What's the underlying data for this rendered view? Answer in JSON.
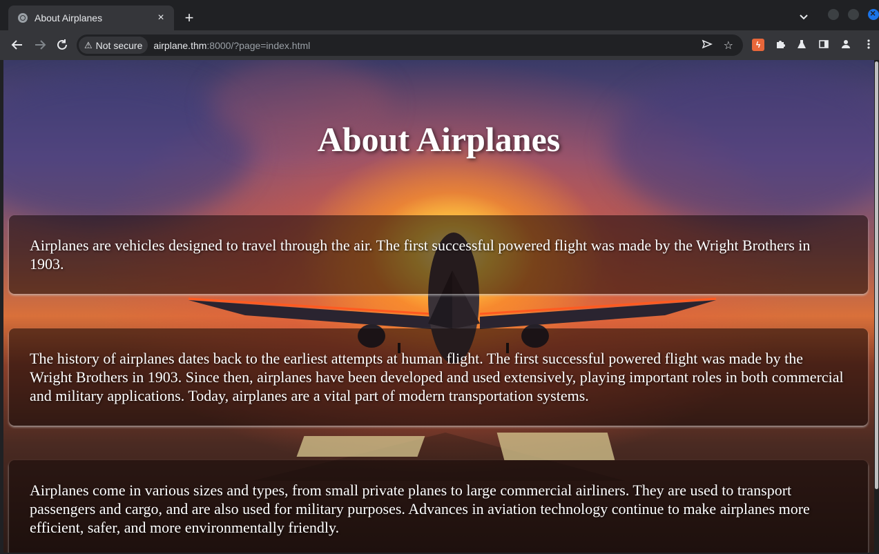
{
  "browser": {
    "tab_title": "About Airplanes",
    "tab_close": "×",
    "new_tab": "+",
    "security_label": "Not secure",
    "url_host": "airplane.thm",
    "url_rest": ":8000/?page=index.html",
    "icons": [
      "back-icon",
      "forward-icon",
      "reload-icon",
      "warning-icon",
      "send-icon",
      "star-icon",
      "burp-extension-icon",
      "puzzle-icon",
      "flask-icon",
      "side-panel-icon",
      "profile-icon",
      "menu-icon"
    ]
  },
  "page": {
    "title": "About Airplanes",
    "paragraphs": [
      "Airplanes are vehicles designed to travel through the air. The first successful powered flight was made by the Wright Brothers in 1903.",
      "The history of airplanes dates back to the earliest attempts at human flight. The first successful powered flight was made by the Wright Brothers in 1903. Since then, airplanes have been developed and used extensively, playing important roles in both commercial and military applications. Today, airplanes are a vital part of modern transportation systems.",
      "Airplanes come in various sizes and types, from small private planes to large commercial airliners. They are used to transport passengers and cargo, and are also used for military purposes. Advances in aviation technology continue to make airplanes more efficient, safer, and more environmentally friendly."
    ]
  }
}
